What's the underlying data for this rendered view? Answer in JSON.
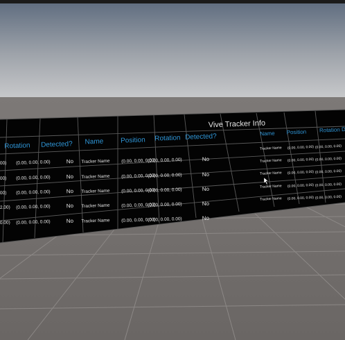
{
  "scene": {
    "sky_top": "#5f6c7e",
    "sky_bottom": "#c2c4c6",
    "ground": "#6f6b69",
    "panel": "#020202",
    "header_color": "#2f95d6",
    "text_color": "#e6e6e6",
    "window_strip": "#1b1b1b"
  },
  "main_table": {
    "headers": [
      "Rotation",
      "Detected?",
      "Name",
      "Position",
      "Rotation",
      "Detected?"
    ],
    "rows": [
      [
        "(0.00, 0.00, 0.00)",
        "No",
        "Tracker Name",
        "(0.00, 0.00, 0.00)",
        "(0.00, 0.00, 0.00)",
        "No"
      ],
      [
        "(0.00, 0.00, 0.00)",
        "No",
        "Tracker Name",
        "(0.00, 0.00, 0.00)",
        "(0.00, 0.00, 0.00)",
        "No"
      ],
      [
        "(0.00, 0.00, 0.00)",
        "No",
        "Tracker Name",
        "(0.00, 0.00, 0.00)",
        "(0.00, 0.00, 0.00)",
        "No"
      ],
      [
        "(0.00, 0.00, 0.00)",
        "No",
        "Tracker Name",
        "(0.00, 0.00, 0.00)",
        "(0.00, 0.00, 0.00)",
        "No"
      ],
      [
        "(0.00, 0.00, 0.00)",
        "No",
        "Tracker Name",
        "(0.00, 0.00, 0.00)",
        "(0.00, 0.00, 0.00)",
        "No"
      ]
    ],
    "left_partial": [
      "00)",
      "00)",
      "00)",
      "2.00)",
      "0.00)"
    ]
  },
  "vive_table": {
    "title": "Vive Tracker Info",
    "headers": [
      "Name",
      "Position",
      "Rotation",
      "D"
    ],
    "rows": [
      [
        "Tracker Name",
        "(0.00, 0.00, 0.00)",
        "(0.00, 0.00, 0.00)"
      ],
      [
        "Tracker Name",
        "(0.00, 0.00, 0.00)",
        "(0.00, 0.00, 0.00)"
      ],
      [
        "Tracker Name",
        "(0.00, 0.00, 0.00)",
        "(0.00, 0.00, 0.00)"
      ],
      [
        "Tracker Name",
        "(0.00, 0.00, 0.00)",
        "(0.00, 0.00, 0.00)"
      ],
      [
        "Tracker Name",
        "(0.00, 0.00, 0.00)",
        "(0.00, 0.00, 0.00)"
      ]
    ]
  }
}
